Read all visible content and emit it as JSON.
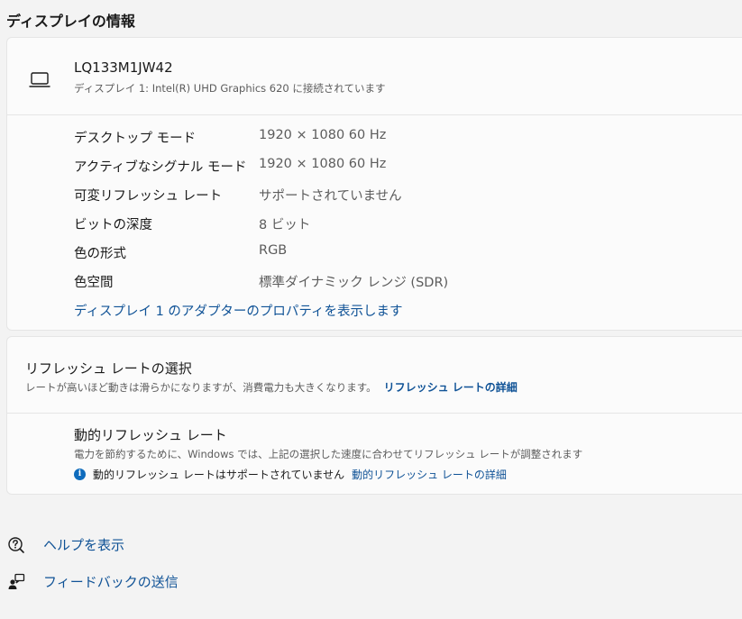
{
  "section": {
    "title": "ディスプレイの情報"
  },
  "device": {
    "name": "LQ133M1JW42",
    "subtitle": "ディスプレイ 1: Intel(R) UHD Graphics 620 に接続されています",
    "icon": "laptop-icon"
  },
  "info_rows": [
    {
      "label": "デスクトップ モード",
      "value": "1920 × 1080 60 Hz"
    },
    {
      "label": "アクティブなシグナル モード",
      "value": "1920 × 1080 60 Hz"
    },
    {
      "label": "可変リフレッシュ レート",
      "value": "サポートされていません"
    },
    {
      "label": "ビットの深度",
      "value": "8 ビット"
    },
    {
      "label": "色の形式",
      "value": "RGB"
    },
    {
      "label": "色空間",
      "value": "標準ダイナミック レンジ (SDR)"
    }
  ],
  "adapter_link": "ディスプレイ 1 のアダプターのプロパティを表示します",
  "refresh": {
    "title": "リフレッシュ レートの選択",
    "subtitle": "レートが高いほど動きは滑らかになりますが、消費電力も大きくなります。",
    "link": "リフレッシュ レートの詳細"
  },
  "dynamic": {
    "title": "動的リフレッシュ レート",
    "subtitle": "電力を節約するために、Windows では、上記の選択した速度に合わせてリフレッシュ レートが調整されます",
    "note": "動的リフレッシュ レートはサポートされていません",
    "note_icon": "i",
    "link": "動的リフレッシュ レートの詳細"
  },
  "footer": {
    "help": "ヘルプを表示",
    "feedback": "フィードバックの送信"
  },
  "colors": {
    "accent": "#0f5296",
    "info": "#0f6cbd"
  }
}
